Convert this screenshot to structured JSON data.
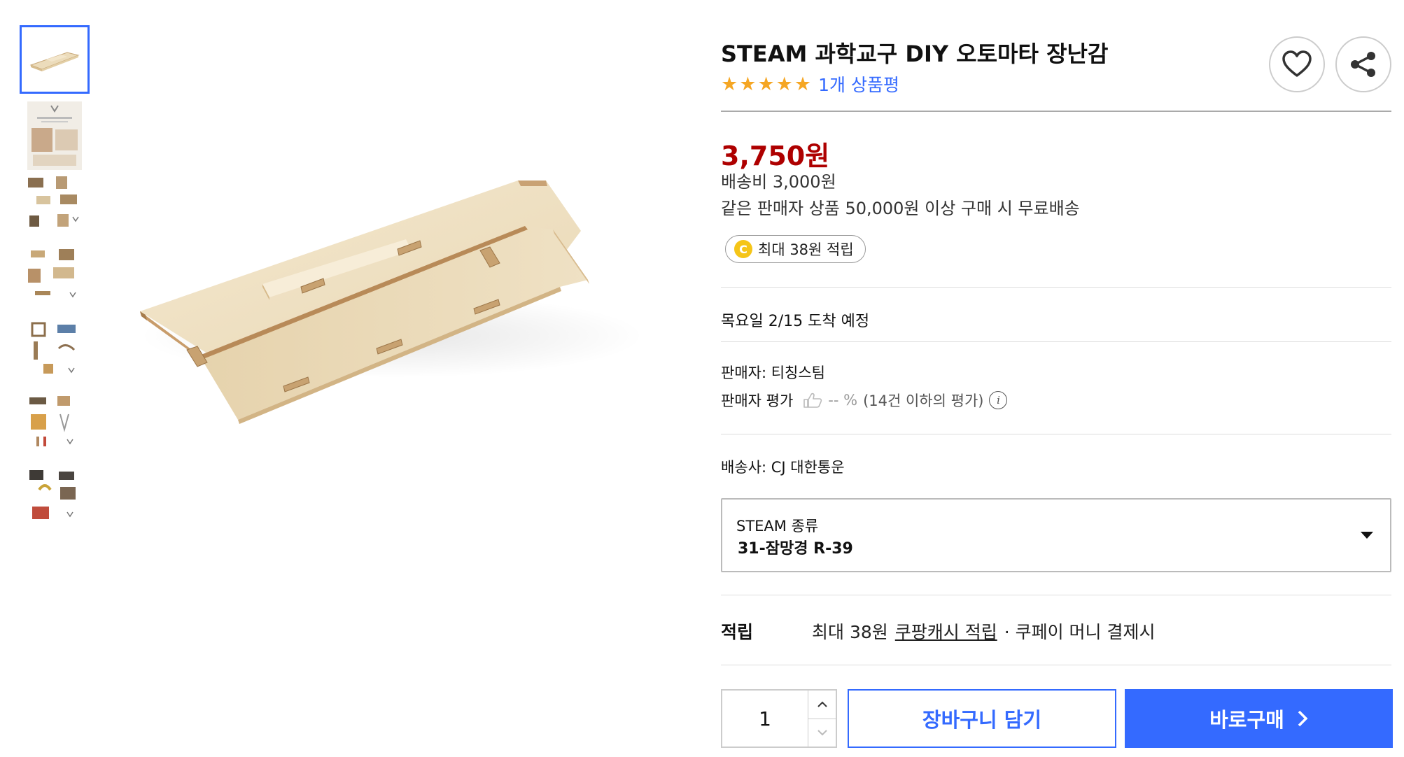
{
  "product": {
    "title": "STEAM 과학교구 DIY 오토마타 장난감",
    "review_link": "1개 상품평",
    "rating_stars": 5
  },
  "price": {
    "value": "3,750원",
    "shipping_fee": "배송비 3,000원",
    "free_shipping": "같은 판매자 상품 50,000원 이상 구매 시 무료배송"
  },
  "cash_badge": {
    "coin": "C",
    "text": "최대 38원 적립"
  },
  "arrival": "목요일 2/15 도착 예정",
  "seller": {
    "name_line": "판매자: 티칭스팀",
    "rating_label": "판매자 평가",
    "rating_value": "-- %",
    "rating_note": "(14건 이하의 평가)",
    "info_icon": "i"
  },
  "courier": "배송사: CJ 대한통운",
  "option": {
    "label": "STEAM 종류",
    "selected": "31-잠망경 R-39"
  },
  "reward": {
    "label": "적립",
    "prefix": "최대 38원",
    "link": "쿠팡캐시 적립",
    "suffix": "· 쿠페이 머니 결제시"
  },
  "purchase": {
    "quantity": "1",
    "cart_label": "장바구니 담기",
    "buy_label": "바로구매"
  },
  "colors": {
    "accent": "#346aff",
    "price": "#ae0000",
    "star": "#f5a623",
    "coin": "#f5c518"
  },
  "icons": [
    "heart-icon",
    "share-icon",
    "thumb-up-icon",
    "info-icon",
    "chevron-up-icon",
    "chevron-down-icon",
    "chevron-right-icon",
    "dropdown-caret-icon",
    "coin-icon"
  ]
}
